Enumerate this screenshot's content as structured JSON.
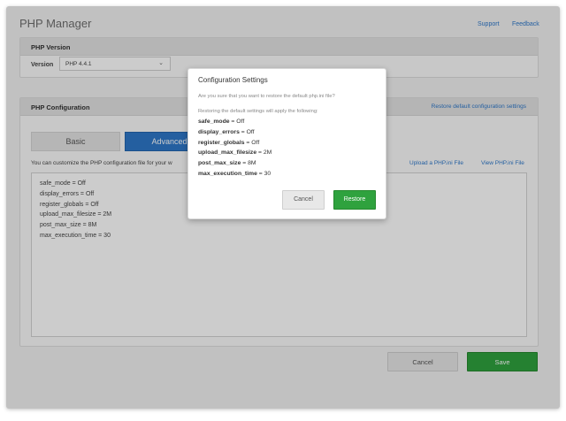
{
  "app": {
    "title": "PHP Manager",
    "support_label": "Support",
    "feedback_label": "Feedback"
  },
  "version_panel": {
    "header": "PHP Version",
    "label": "Version",
    "selected": "PHP 4.4.1"
  },
  "config_panel": {
    "header": "PHP Configuration",
    "restore_link": "Restore default configuration settings",
    "tabs": [
      {
        "label": "Basic",
        "active": false
      },
      {
        "label": "Advanced",
        "active": true
      }
    ],
    "description": "You can customize the PHP configuration file for your w",
    "upload_link": "Upload a PHP.ini File",
    "view_link": "View PHP.ini File",
    "ini_lines": [
      "safe_mode = Off",
      "display_errors = Off",
      "register_globals = Off",
      "upload_max_filesize = 2M",
      "post_max_size = 8M",
      "max_execution_time = 30"
    ]
  },
  "footer": {
    "cancel_label": "Cancel",
    "save_label": "Save"
  },
  "dialog": {
    "title": "Configuration Settings",
    "question": "Are you sure that you want to restore the default php.ini file?",
    "intro": "Restoring the default settings will apply the following:",
    "settings": [
      {
        "key": "safe_mode",
        "value": " = Off"
      },
      {
        "key": "display_errors",
        "value": " = Off"
      },
      {
        "key": "register_globals",
        "value": " = Off"
      },
      {
        "key": "upload_max_filesize",
        "value": " = 2M"
      },
      {
        "key": "post_max_size",
        "value": " = 8M"
      },
      {
        "key": "max_execution_time",
        "value": " = 30"
      }
    ],
    "cancel_label": "Cancel",
    "restore_label": "Restore"
  },
  "colors": {
    "accent_blue": "#2d77c9",
    "save_green": "#2fa23e",
    "overlay": "rgba(0,0,0,0.2)"
  },
  "icons": {
    "select_chevron": "chevron-down-icon"
  }
}
